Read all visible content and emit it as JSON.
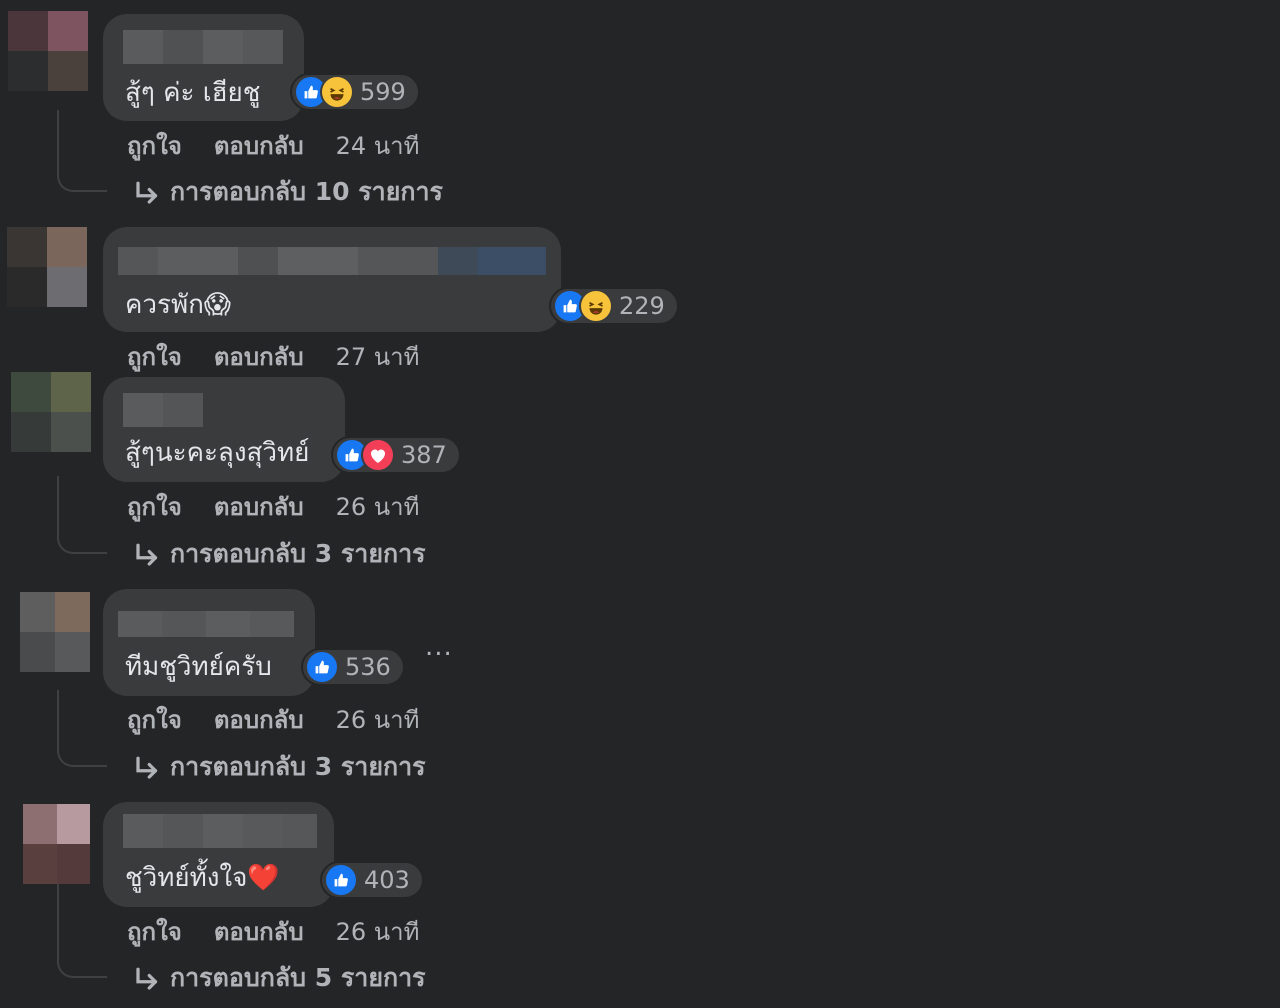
{
  "labels": {
    "like": "ถูกใจ",
    "reply": "ตอบกลับ"
  },
  "colors": {
    "background": "#242526",
    "bubble": "#3a3b3c",
    "like": "#1877f2",
    "haha": "#f7c33a",
    "love": "#f33e58"
  },
  "comments": [
    {
      "text": "สู้ๆ ค่ะ เฮียชู",
      "reactions": [
        "like-icon",
        "haha-icon"
      ],
      "reaction_count": "599",
      "time": "24 นาที",
      "replies": "การตอบกลับ 10 รายการ"
    },
    {
      "text": "ควรพัก😱",
      "reactions": [
        "like-icon",
        "haha-icon"
      ],
      "reaction_count": "229",
      "time": "27 นาที",
      "replies": ""
    },
    {
      "text": "สู้ๆนะคะลุงสุวิทย์",
      "reactions": [
        "like-icon",
        "love-icon"
      ],
      "reaction_count": "387",
      "time": "26 นาที",
      "replies": "การตอบกลับ 3 รายการ"
    },
    {
      "text": "ทีมชูวิทย์ครับ",
      "reactions": [
        "like-icon"
      ],
      "reaction_count": "536",
      "time": "26 นาที",
      "replies": "การตอบกลับ 3 รายการ",
      "more_menu": "..."
    },
    {
      "text": "ชูวิทย์ทั้งใจ❤️",
      "reactions": [
        "like-icon"
      ],
      "reaction_count": "403",
      "time": "26 นาที",
      "replies": "การตอบกลับ 5 รายการ"
    }
  ]
}
